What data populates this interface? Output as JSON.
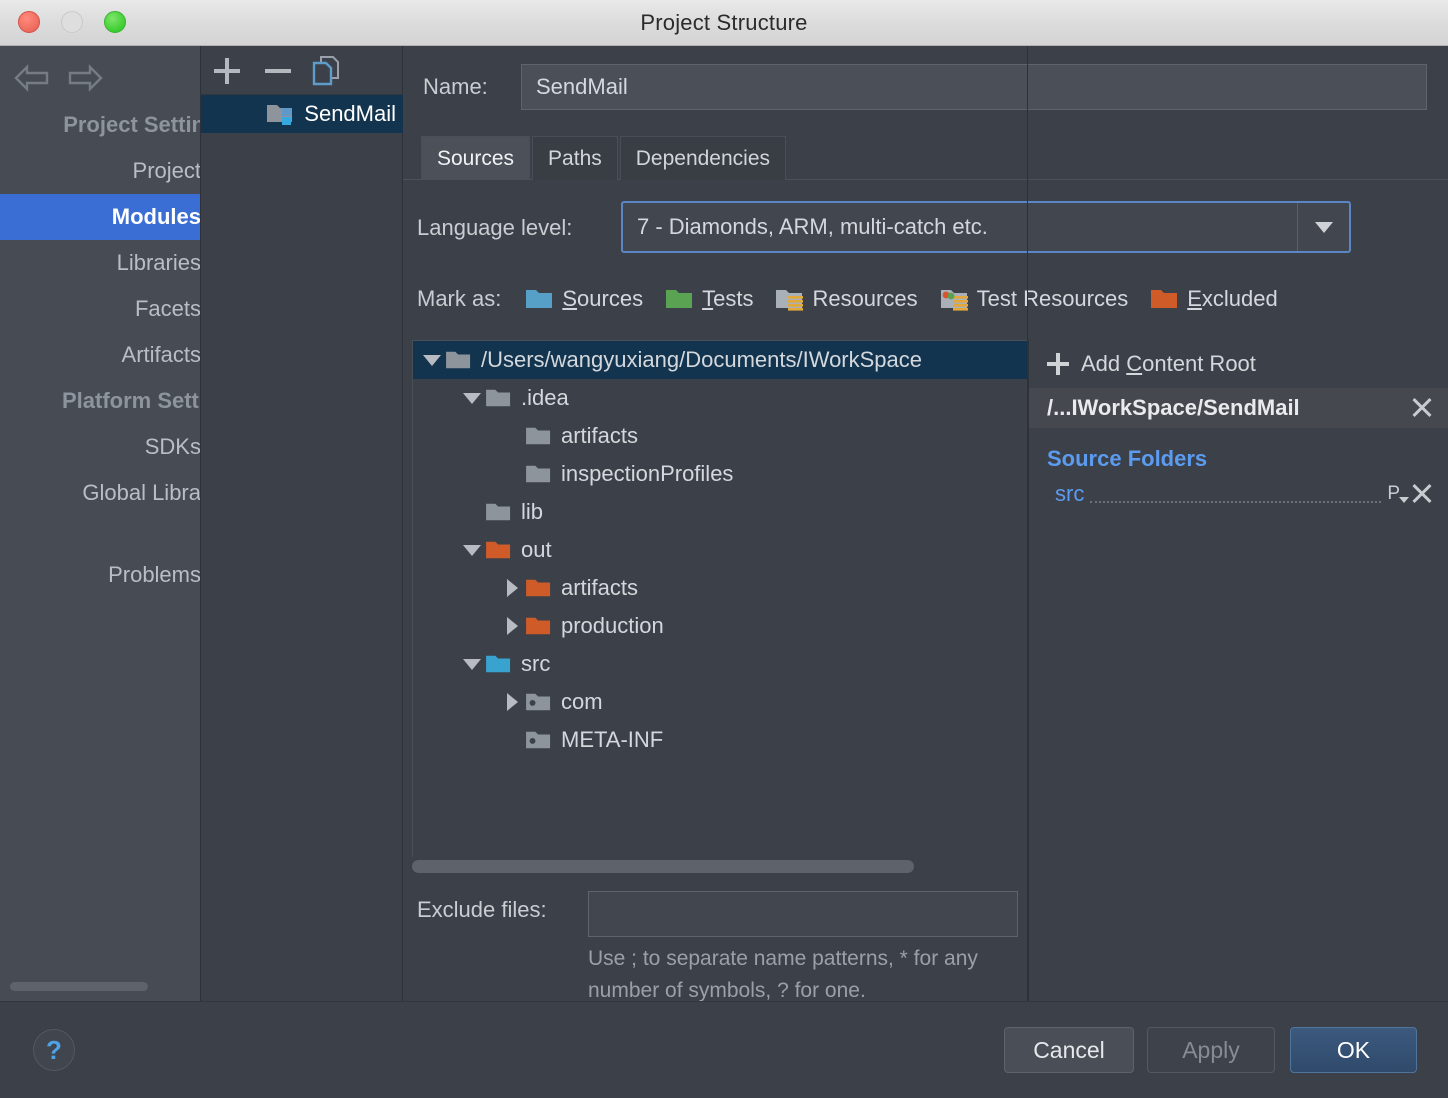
{
  "window": {
    "title": "Project Structure",
    "traffic_lights": [
      "close-red",
      "minimize-disabled",
      "zoom-green"
    ]
  },
  "sidebar": {
    "nav": {
      "back": "back-arrow",
      "forward": "forward-arrow"
    },
    "groups": [
      {
        "label": "Project Settin",
        "type": "header"
      },
      {
        "label": "Project",
        "type": "item",
        "selected": false
      },
      {
        "label": "Modules",
        "type": "item",
        "selected": true
      },
      {
        "label": "Libraries",
        "type": "item",
        "selected": false
      },
      {
        "label": "Facets",
        "type": "item",
        "selected": false
      },
      {
        "label": "Artifacts",
        "type": "item",
        "selected": false
      },
      {
        "label": "Platform Setti",
        "type": "header"
      },
      {
        "label": "SDKs",
        "type": "item",
        "selected": false
      },
      {
        "label": "Global Libra",
        "type": "item",
        "selected": false
      },
      {
        "label": "Problems",
        "type": "item",
        "selected": false
      }
    ]
  },
  "modules_panel": {
    "toolbar": {
      "add": "+",
      "remove": "−",
      "copy": "copy-icon"
    },
    "items": [
      {
        "label": "SendMail",
        "selected": true
      }
    ]
  },
  "main": {
    "name_label": "Name:",
    "name_value": "SendMail",
    "tabs": [
      {
        "label": "Sources",
        "active": true
      },
      {
        "label": "Paths",
        "active": false
      },
      {
        "label": "Dependencies",
        "active": false
      }
    ],
    "language_level": {
      "label": "Language level:",
      "value": "7 - Diamonds, ARM, multi-catch etc."
    },
    "mark_as": {
      "label": "Mark as:",
      "options": [
        {
          "label": "Sources",
          "mnemonic": "S",
          "color": "#56a0c8"
        },
        {
          "label": "Tests",
          "mnemonic": "T",
          "color": "#59a352"
        },
        {
          "label": "Resources",
          "mnemonic": "",
          "color": "#a9b0b8"
        },
        {
          "label": "Test Resources",
          "mnemonic": "",
          "color": "#a9b0b8"
        },
        {
          "label": "Excluded",
          "mnemonic": "E",
          "color": "#cf5b28"
        }
      ]
    },
    "tree": [
      {
        "label": "/Users/wangyuxiang/Documents/IWorkSpace",
        "depth": 0,
        "twisty": "down",
        "folder": "gray",
        "selected": true
      },
      {
        "label": ".idea",
        "depth": 1,
        "twisty": "down",
        "folder": "gray",
        "selected": false
      },
      {
        "label": "artifacts",
        "depth": 2,
        "twisty": "none",
        "folder": "gray",
        "selected": false
      },
      {
        "label": "inspectionProfiles",
        "depth": 2,
        "twisty": "none",
        "folder": "gray",
        "selected": false
      },
      {
        "label": "lib",
        "depth": 1,
        "twisty": "none",
        "folder": "gray",
        "selected": false
      },
      {
        "label": "out",
        "depth": 1,
        "twisty": "down",
        "folder": "orange",
        "selected": false
      },
      {
        "label": "artifacts",
        "depth": 2,
        "twisty": "right",
        "folder": "orange",
        "selected": false
      },
      {
        "label": "production",
        "depth": 2,
        "twisty": "right",
        "folder": "orange",
        "selected": false
      },
      {
        "label": "src",
        "depth": 1,
        "twisty": "down",
        "folder": "blue",
        "selected": false
      },
      {
        "label": "com",
        "depth": 2,
        "twisty": "right",
        "folder": "package",
        "selected": false
      },
      {
        "label": "META-INF",
        "depth": 2,
        "twisty": "none",
        "folder": "package",
        "selected": false
      }
    ],
    "exclude": {
      "label": "Exclude files:",
      "value": "",
      "hint": "Use ; to separate name patterns, * for any number of symbols, ? for one."
    }
  },
  "content_roots": {
    "add_label": "Add Content Root",
    "add_mnemonic": "C",
    "root": {
      "path": "/...IWorkSpace/SendMail",
      "remove": "remove-icon"
    },
    "sections": [
      {
        "title": "Source Folders",
        "entries": [
          {
            "name": "src",
            "package_prefix_icon": "P",
            "remove": "remove-icon"
          }
        ]
      }
    ]
  },
  "footer": {
    "help": "?",
    "buttons": [
      {
        "label": "Cancel",
        "kind": "cancel"
      },
      {
        "label": "Apply",
        "kind": "apply-disabled"
      },
      {
        "label": "OK",
        "kind": "default"
      }
    ]
  },
  "colors": {
    "window_bg": "#3c4048",
    "sidebar_bg": "#464b54",
    "selection_blue": "#3b6ed4",
    "tree_selection": "#12344f",
    "link_blue": "#5b9bf0",
    "focus_border": "#5c86c3"
  }
}
